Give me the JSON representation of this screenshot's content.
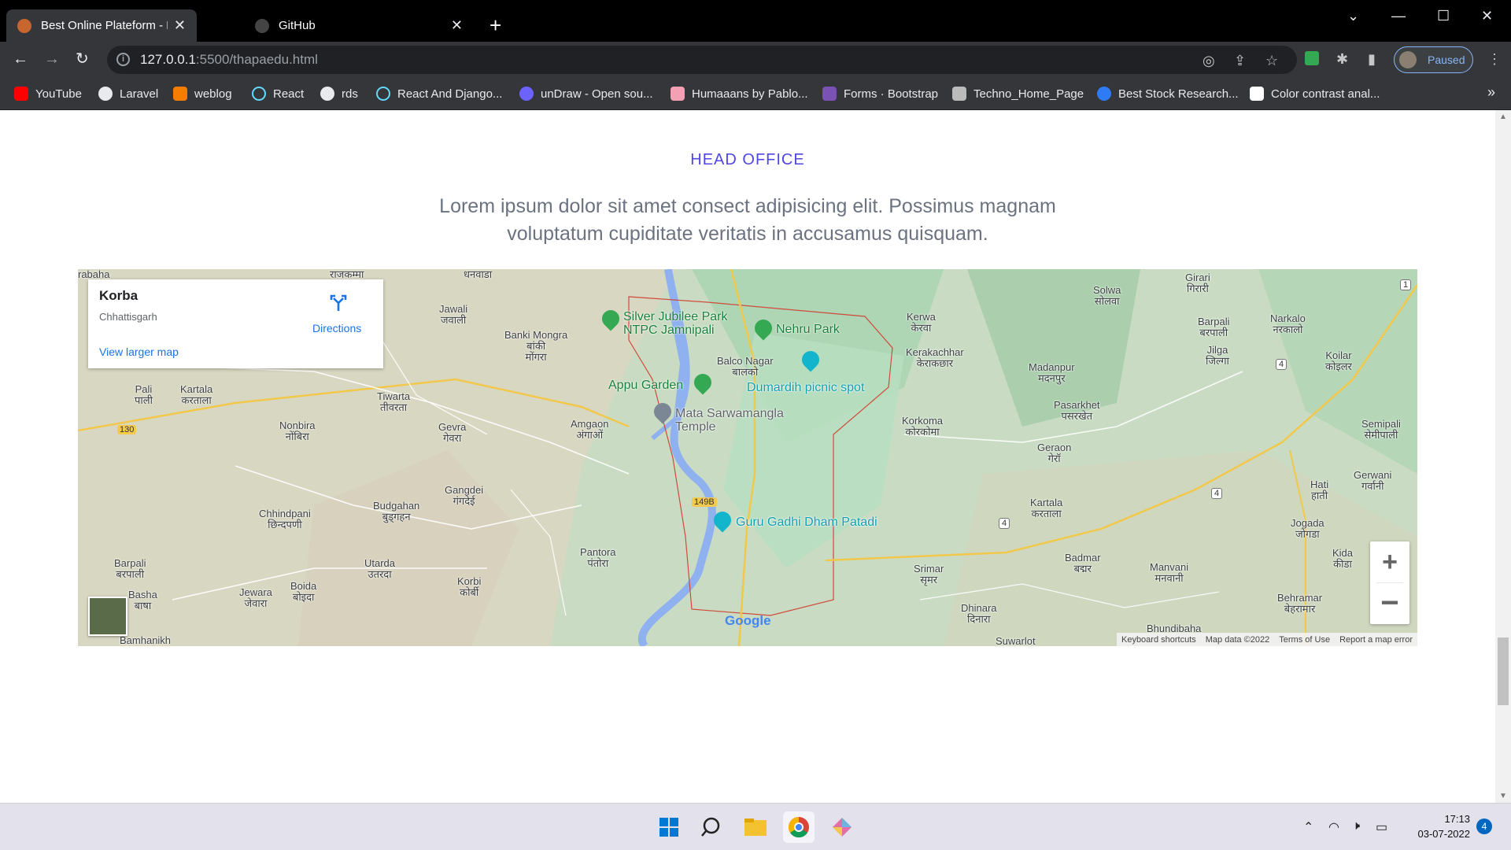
{
  "browser": {
    "tabs": [
      {
        "title": "Best Online Plateform - Education",
        "active": true
      },
      {
        "title": "GitHub",
        "active": false
      }
    ],
    "url": {
      "host": "127.0.0.1",
      "path": ":5500/thapaedu.html"
    },
    "profile_label": "Paused",
    "bookmarks": [
      {
        "label": "YouTube",
        "icon": "youtube-icon",
        "color": "#ff0000"
      },
      {
        "label": "Laravel",
        "icon": "globe-icon",
        "color": "#e8eaed"
      },
      {
        "label": "weblog",
        "icon": "blogger-icon",
        "color": "#f57d00"
      },
      {
        "label": "React",
        "icon": "react-icon",
        "color": "#61dafb"
      },
      {
        "label": "rds",
        "icon": "globe-icon",
        "color": "#e8eaed"
      },
      {
        "label": "React And Django...",
        "icon": "react-icon",
        "color": "#61dafb"
      },
      {
        "label": "unDraw - Open sou...",
        "icon": "undraw-icon",
        "color": "#6c63ff"
      },
      {
        "label": "Humaaans by Pablo...",
        "icon": "humaaans-icon",
        "color": "#f3a0b5"
      },
      {
        "label": "Forms · Bootstrap",
        "icon": "bootstrap-icon",
        "color": "#7952b3"
      },
      {
        "label": "Techno_Home_Page",
        "icon": "techno-icon",
        "color": "#bbbbbb"
      },
      {
        "label": "Best Stock Research...",
        "icon": "stock-icon",
        "color": "#2f7bf5"
      },
      {
        "label": "Color contrast anal...",
        "icon": "contrast-icon",
        "color": "#ffffff"
      }
    ]
  },
  "page": {
    "section_title": "HEAD OFFICE",
    "description": "Lorem ipsum dolor sit amet consect adipisicing elit. Possimus magnam voluptatum cupiditate veritatis in accusamus quisquam."
  },
  "map": {
    "place_name": "Korba",
    "place_region": "Chhattisgarh",
    "directions_label": "Directions",
    "larger_map_label": "View larger map",
    "poi": [
      {
        "label": "Silver Jubilee Park\nNTPC Jamnipali",
        "type": "park"
      },
      {
        "label": "Nehru Park",
        "type": "park"
      },
      {
        "label": "Appu Garden",
        "type": "park"
      },
      {
        "label": "Dumardih picnic spot",
        "type": "attraction"
      },
      {
        "label": "Mata Sarwamangla\nTemple",
        "type": "temple"
      },
      {
        "label": "Guru Gadhi Dham Patadi",
        "type": "monument"
      }
    ],
    "places": [
      "rabaha",
      "राजकम्मा",
      "धनवाडा",
      "Jawali\nजवाली",
      "Banki Mongra\nबांकी\nमोंगरा",
      "Balco Nagar\nबालको",
      "Kerwa\nकेरवा",
      "Kerakachhar\nकेराकछार",
      "Solwa\nसोलवा",
      "Girari\nगिरारी",
      "Barpali\nबरपाली",
      "Narkalo\nनरकालो",
      "Jilga\nजिल्गा",
      "Koilar\nकोइलर",
      "Madanpur\nमदनपुर",
      "Pali\nपाली",
      "Kartala\nकरताला",
      "Tiwarta\nतीवरता",
      "Nonbira\nनोंबिरा",
      "Gevra\nगेवरा",
      "Amgaon\nअंगाओं",
      "Korkoma\nकोरकोमा",
      "Pasarkhet\nपसरखेत",
      "Semipali\nसेमीपाली",
      "Geraon\nगेरॉ",
      "Gerwani\nगर्वानी",
      "Hati\nहाती",
      "Gangdei\nगंगदेई",
      "Chhindpani\nछिन्दपणी",
      "Budgahan\nबुड्गहन",
      "Kartala\nकरताला",
      "Jogada\nजोगडा",
      "Pantora\nपंतोरा",
      "Barpali\nबरपाली",
      "Utarda\nउतरदा",
      "Korbi\nकोर्बी",
      "Srimar\nसृमर",
      "Badmar\nबद्मर",
      "Manvani\nमनवानी",
      "Kida\nकीडा",
      "Basha\nबाषा",
      "Jewara\nजेवारा",
      "Boida\nबोइदा",
      "Dhinara\nदिनारा",
      "Behramar\nबेहरामार",
      "Bhundibaha",
      "Bamhanikh",
      "Suwarlot"
    ],
    "road_shields": [
      "130",
      "149B",
      "4",
      "4",
      "4",
      "1"
    ],
    "footer": [
      "Keyboard shortcuts",
      "Map data ©2022",
      "Terms of Use",
      "Report a map error"
    ],
    "google": "Google"
  },
  "taskbar": {
    "time": "17:13",
    "date": "03-07-2022",
    "notifications": "4"
  }
}
